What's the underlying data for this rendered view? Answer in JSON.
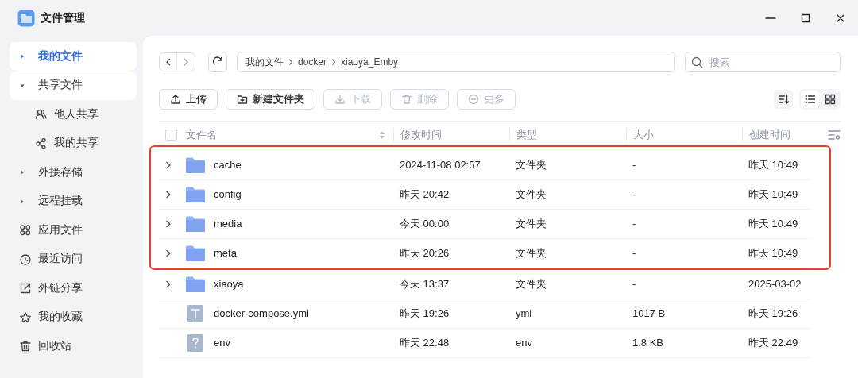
{
  "window": {
    "title": "文件管理"
  },
  "sidebar": {
    "items": [
      {
        "label": "我的文件",
        "kind": "group",
        "selected": true,
        "expanded": false
      },
      {
        "label": "共享文件",
        "kind": "group",
        "selected": false,
        "expanded": true,
        "children": [
          {
            "label": "他人共享",
            "kind": "link",
            "selected": false
          },
          {
            "label": "我的共享",
            "kind": "link",
            "selected": false
          }
        ]
      },
      {
        "label": "外接存储",
        "kind": "group",
        "selected": false,
        "expanded": false
      },
      {
        "label": "远程挂载",
        "kind": "group",
        "selected": false,
        "expanded": false
      },
      {
        "label": "应用文件",
        "kind": "link",
        "selected": false
      },
      {
        "label": "最近访问",
        "kind": "link",
        "selected": false
      },
      {
        "label": "外链分享",
        "kind": "link",
        "selected": false
      },
      {
        "label": "我的收藏",
        "kind": "link",
        "selected": false
      },
      {
        "label": "回收站",
        "kind": "link",
        "selected": false
      }
    ]
  },
  "breadcrumb": [
    "我的文件",
    "docker",
    "xiaoya_Emby"
  ],
  "search": {
    "placeholder": "搜索"
  },
  "actions": [
    {
      "label": "上传",
      "disabled": false
    },
    {
      "label": "新建文件夹",
      "disabled": false
    },
    {
      "label": "下载",
      "disabled": true
    },
    {
      "label": "删除",
      "disabled": true
    },
    {
      "label": "更多",
      "disabled": true
    }
  ],
  "views": [
    {
      "kind": "list",
      "selected": true
    },
    {
      "kind": "grid",
      "selected": false
    }
  ],
  "table": {
    "select_all": {
      "checked": false
    },
    "columns": [
      {
        "label": "文件名",
        "sortable": true
      },
      {
        "label": "修改时间",
        "sortable": false
      },
      {
        "label": "类型",
        "sortable": false
      },
      {
        "label": "大小",
        "sortable": false
      },
      {
        "label": "创建时间",
        "sortable": false
      }
    ],
    "rows": [
      {
        "kind": "folder",
        "name": "cache",
        "modified": "2024-11-08 02:57",
        "type": "文件夹",
        "size": "-",
        "created": "昨天 10:49",
        "highlighted": true
      },
      {
        "kind": "folder",
        "name": "config",
        "modified": "昨天 20:42",
        "type": "文件夹",
        "size": "-",
        "created": "昨天 10:49",
        "highlighted": true
      },
      {
        "kind": "folder",
        "name": "media",
        "modified": "今天 00:00",
        "type": "文件夹",
        "size": "-",
        "created": "昨天 10:49",
        "highlighted": true
      },
      {
        "kind": "folder",
        "name": "meta",
        "modified": "昨天 20:26",
        "type": "文件夹",
        "size": "-",
        "created": "昨天 10:49",
        "highlighted": true
      },
      {
        "kind": "folder",
        "name": "xiaoya",
        "modified": "今天 13:37",
        "type": "文件夹",
        "size": "-",
        "created": "2025-03-02",
        "highlighted": false
      },
      {
        "kind": "text",
        "name": "docker-compose.yml",
        "modified": "昨天 19:26",
        "type": "yml",
        "size": "1017 B",
        "created": "昨天 19:26",
        "highlighted": false
      },
      {
        "kind": "unknown",
        "name": "env",
        "modified": "昨天 22:48",
        "type": "env",
        "size": "1.8 KB",
        "created": "昨天 22:49",
        "highlighted": false
      }
    ]
  }
}
